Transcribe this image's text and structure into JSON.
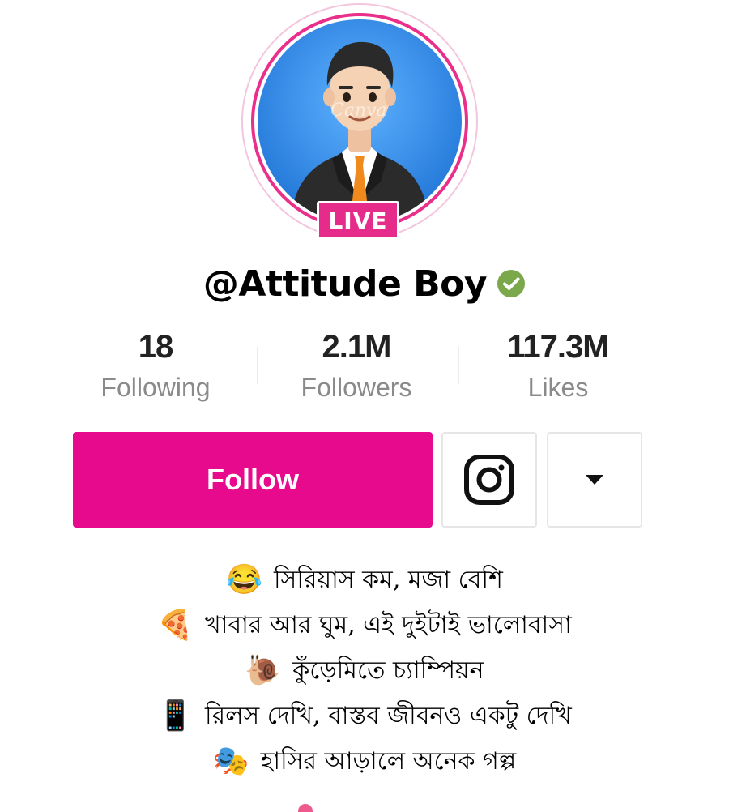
{
  "profile": {
    "username": "@Attitude Boy",
    "verified": true,
    "live_label": "LIVE",
    "watermark": "Canva",
    "avatar_icon": "businessman-avatar"
  },
  "stats": [
    {
      "value": "18",
      "label": "Following"
    },
    {
      "value": "2.1M",
      "label": "Followers"
    },
    {
      "value": "117.3M",
      "label": "Likes"
    }
  ],
  "actions": {
    "follow_label": "Follow",
    "instagram_icon": "instagram-icon",
    "dropdown_icon": "caret-down-icon"
  },
  "bio": [
    {
      "emoji": "😂",
      "text": "সিরিয়াস কম, মজা বেশি"
    },
    {
      "emoji": "🍕",
      "text": "খাবার আর ঘুম, এই দুইটাই ভালোবাসা"
    },
    {
      "emoji": "🐌",
      "text": "কুঁড়েমিতে চ্যাম্পিয়ন"
    },
    {
      "emoji": "📱",
      "text": "রিলস দেখি, বাস্তব জীবনও একটু দেখি"
    },
    {
      "emoji": "🎭",
      "text": "হাসির আড়ালে অনেক গল্প"
    }
  ],
  "colors": {
    "accent": "#e80a8d",
    "live_badge": "#e62c8a",
    "verified": "#7aa84a",
    "avatar_bg": "#2f8fe8"
  }
}
